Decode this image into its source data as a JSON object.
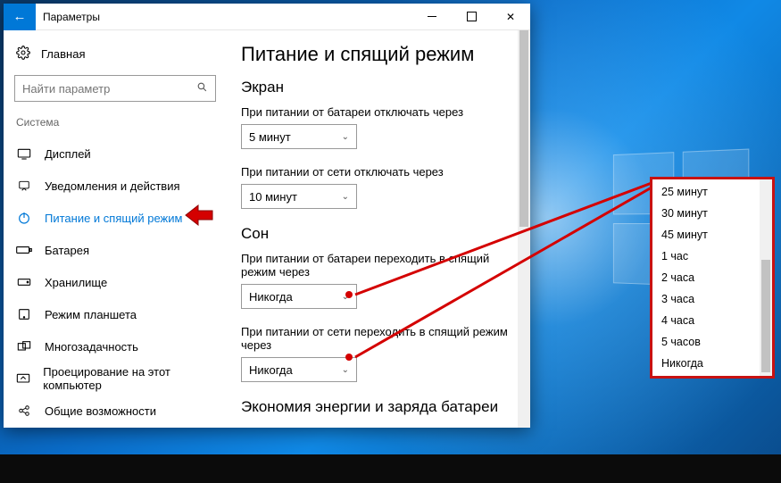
{
  "window": {
    "title": "Параметры",
    "home_label": "Главная",
    "search_placeholder": "Найти параметр",
    "section_label": "Система"
  },
  "nav": {
    "items": [
      {
        "label": "Дисплей"
      },
      {
        "label": "Уведомления и действия"
      },
      {
        "label": "Питание и спящий режим"
      },
      {
        "label": "Батарея"
      },
      {
        "label": "Хранилище"
      },
      {
        "label": "Режим планшета"
      },
      {
        "label": "Многозадачность"
      },
      {
        "label": "Проецирование на этот компьютер"
      },
      {
        "label": "Общие возможности"
      }
    ]
  },
  "content": {
    "page_title": "Питание и спящий режим",
    "screen_heading": "Экран",
    "screen_battery_label": "При питании от батареи отключать через",
    "screen_battery_value": "5 минут",
    "screen_ac_label": "При питании от сети отключать через",
    "screen_ac_value": "10 минут",
    "sleep_heading": "Сон",
    "sleep_battery_label": "При питании от батареи переходить в спящий режим через",
    "sleep_battery_value": "Никогда",
    "sleep_ac_label": "При питании от сети переходить в спящий режим через",
    "sleep_ac_value": "Никогда",
    "saving_heading": "Экономия энергии и заряда батареи"
  },
  "dropdown": {
    "options": [
      "25 минут",
      "30 минут",
      "45 минут",
      "1 час",
      "2 часа",
      "3 часа",
      "4 часа",
      "5 часов",
      "Никогда"
    ]
  }
}
